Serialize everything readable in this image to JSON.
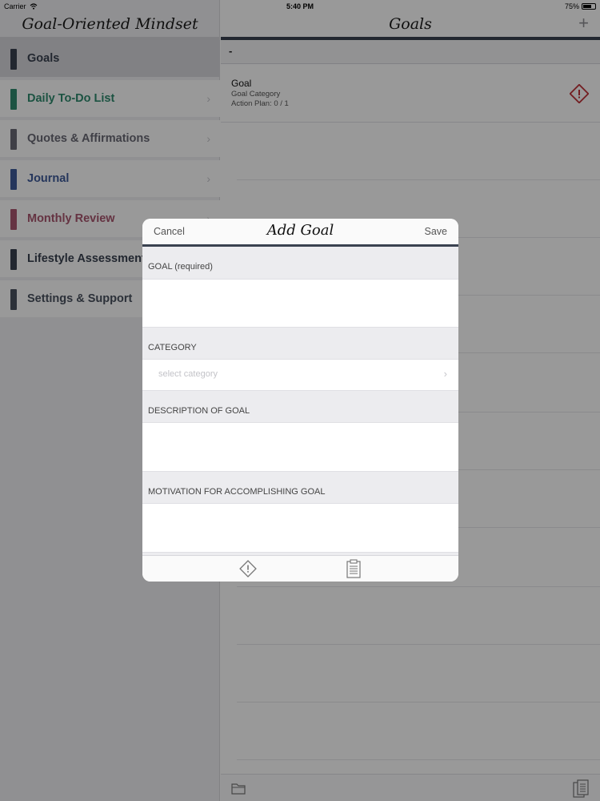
{
  "status_bar": {
    "carrier": "Carrier",
    "time": "5:40 PM",
    "battery": "75%",
    "battery_level": 0.75
  },
  "sidebar": {
    "title": "Goal-Oriented Mindset",
    "items": [
      {
        "label": "Goals",
        "color": "#3a4250",
        "text_color": "#3a4250",
        "active": true,
        "chevron": ""
      },
      {
        "label": "Daily To-Do List",
        "color": "#2f8a6e",
        "text_color": "#2f8a6e",
        "active": false,
        "chevron": "›"
      },
      {
        "label": "Quotes & Affirmations",
        "color": "#6a6a76",
        "text_color": "#6a6a76",
        "active": false,
        "chevron": "›"
      },
      {
        "label": "Journal",
        "color": "#3f5b9a",
        "text_color": "#3f5b9a",
        "active": false,
        "chevron": "›"
      },
      {
        "label": "Monthly Review",
        "color": "#a8566e",
        "text_color": "#a8566e",
        "active": false,
        "chevron": "›"
      },
      {
        "label": "Lifestyle Assessment",
        "color": "#3a4250",
        "text_color": "#3a4250",
        "active": false,
        "chevron": ""
      },
      {
        "label": "Settings & Support",
        "color": "#4a5260",
        "text_color": "#4a5260",
        "active": false,
        "chevron": ""
      }
    ]
  },
  "main": {
    "title": "Goals",
    "add_label": "+",
    "section_label": "-",
    "goal": {
      "title": "Goal",
      "category": "Goal Category",
      "action_plan": "Action Plan:  0 / 1"
    }
  },
  "modal": {
    "title": "Add Goal",
    "cancel_label": "Cancel",
    "save_label": "Save",
    "goal_label": "GOAL (required)",
    "category_label": "CATEGORY",
    "category_placeholder": "select category",
    "category_chevron": "›",
    "description_label": "DESCRIPTION OF GOAL",
    "motivation_label": "MOTIVATION FOR ACCOMPLISHING GOAL"
  },
  "colors": {
    "accent": "#3a4250",
    "warning": "#c0343a"
  }
}
